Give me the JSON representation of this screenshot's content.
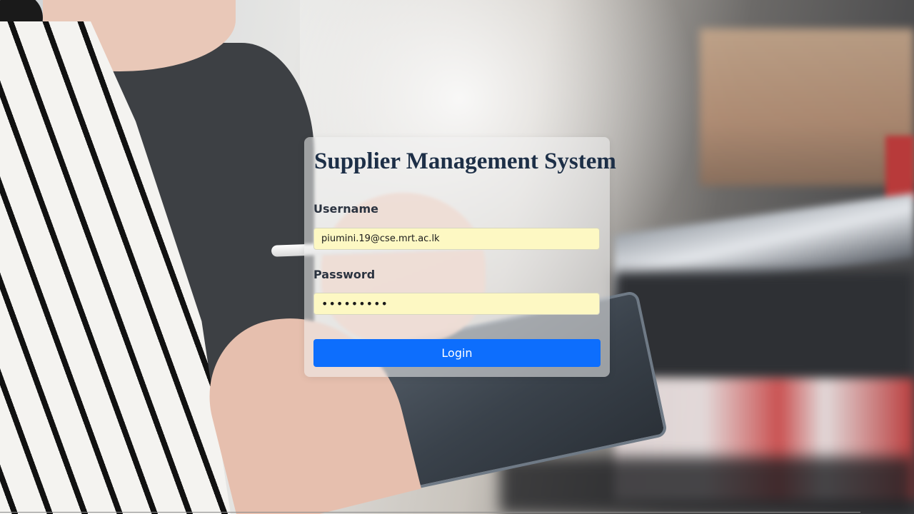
{
  "login": {
    "title": "Supplier Management System",
    "username_label": "Username",
    "username_value": "piumini.19@cse.mrt.ac.lk",
    "password_label": "Password",
    "password_value": "•••••••••",
    "button_label": "Login"
  },
  "colors": {
    "title": "#1d2f47",
    "input_autofill_bg": "#fdf8c3",
    "button_primary": "#0d6efd"
  }
}
